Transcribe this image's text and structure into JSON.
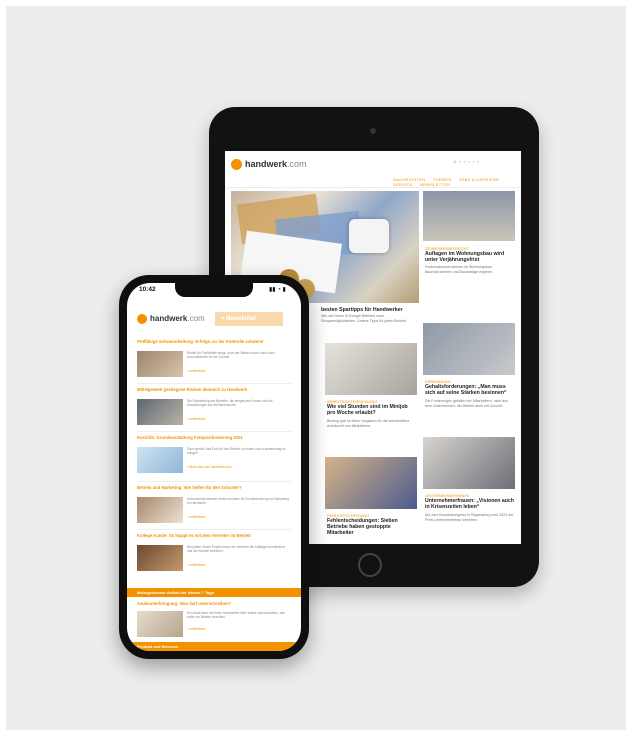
{
  "tablet": {
    "logo": {
      "brand": "handwerk",
      "tld": ".com"
    },
    "nav": [
      "NACHRICHTEN",
      "THEMEN",
      "JOBS & KARRIERE",
      "SERVICE",
      "NEWSLETTER"
    ],
    "hero": {
      "title": "besten Spartipps für Handwerker",
      "text": "Wie viel Strom & Energie Betriebe nach Einsparmöglichkeiten. Unsere Tipps für jeden Betrieb."
    },
    "side": [
      {
        "label": "GEWERBEMIETRECHT",
        "title": "Auflagen im Wohnungsbau wird unter Verjährungsfrist",
        "text": "Fristversäumnis können im Wohnungsbau Baumaßnahmen und Bauanträge ergeben."
      },
      {
        "label": "ERNENNUNG",
        "title": "Gehaltsforderungen: „Man muss sich auf seine Stärken besinnen“",
        "text": "Die Forderungen gefallen nur Mitarbeitern, nicht aus dem Unternehmen, der Betrieb auch mit Zukunft."
      },
      {
        "label": "UNTERNEHMERINNEN",
        "title": "Unternehmerfrauen: „Visionen auch in Krisenzeiten leben“",
        "text": "Auf dem Bundeskongress in Regensburg wird 2023 der Preis Unternehmerfrau verliehen."
      }
    ],
    "mid": [
      {
        "label": "ARBEITSZEITERFASSUNG",
        "title": "Wie viel Stunden sind im Minijob pro Woche erlaubt?",
        "text": "Bislang gab es keine Vorgaben für die wöchentliche Arbeitszeit von Minijobbern."
      },
      {
        "label": "FEHLENTSCHEIDUNG",
        "title": "Fehlentscheidungen: Sieben Betriebe haben gestoppte Mitarbeiter",
        "text": ""
      }
    ]
  },
  "phone": {
    "time": "10:42",
    "status": "▮▮ ◔ ▮",
    "logo": {
      "brand": "handwerk",
      "tld": ".com"
    },
    "newsletter_label": "» Newsletter",
    "items": [
      {
        "title": "Prüffähige Schwerarbeitung: Erfolge, an der Kontrolle schwerer",
        "text": "Bedarf für Fachkräfte steigt, doch der Betrieb sucht auch noch Auszubildende für die Zukunft.",
        "more": "» weiterlesen"
      },
      {
        "title": "Mittelgewerk gestiegene Risiken dennoch zu Handwerk",
        "text": "Die Entwicklung der Betriebe, die steigenden Kosten und die Auswirkungen auf die Baubranche.",
        "more": "» weiterlesen"
      },
      {
        "title": "Kurzinfo: Grundausstattung Fotopositionierung 2023",
        "text": "Dazu gehört, das Foto für den Betrieb zu finden und in Anwendung zu bringen.",
        "more": "» Mehr dazu auf handwerk.com"
      },
      {
        "title": "Betrieb und Marketing: Wie helfen für den Schuster?",
        "text": "Unternehmensberater finden Ansätze für Kundenbindung und Marketing im Handwerk.",
        "more": "» weiterlesen"
      },
      {
        "title": "Kollege Kunde: So klappt es mit dem Vertreter im Betrieb",
        "text": "Bei jedem neuen Projekt muss der Vertreter die Aufträge koordinieren und die Kunden betreuen.",
        "more": "» weiterlesen"
      }
    ],
    "band1": "Meistgelesener Artikel der letzten 7 Tage",
    "extra": {
      "title": "Azubiunterbringung: Was darf unterschreiben?",
      "text": "Ein Azubi kann ab einem bestimmten Alter selbst unterschreiben, das sollte der Betrieb beachten.",
      "more": "» weiterlesen"
    },
    "band2": "Produkt und Services"
  }
}
